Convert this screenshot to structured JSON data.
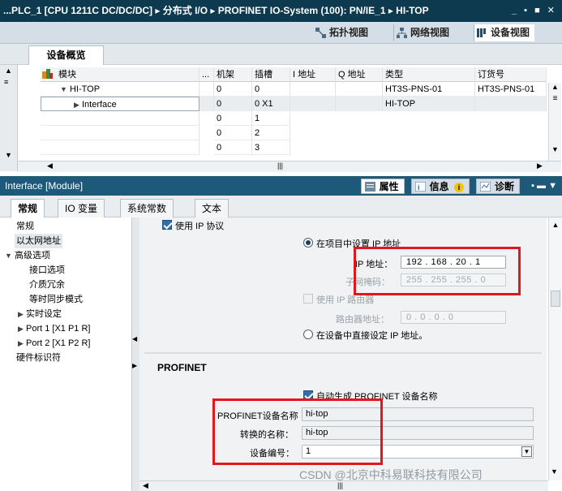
{
  "title_bar": {
    "path": "...PLC_1 [CPU 1211C DC/DC/DC]  ▸  分布式 I/O  ▸  PROFINET IO-System (100): PN/IE_1  ▸  HI-TOP",
    "controls": "_ ▪ ■ ✕"
  },
  "view_tabs": [
    "拓扑视图",
    "网络视图",
    "设备视图"
  ],
  "overview": {
    "tab_label": "设备概览",
    "columns": [
      "模块",
      "...",
      "机架",
      "插槽",
      "I 地址",
      "Q 地址",
      "类型",
      "订货号"
    ],
    "rows": [
      {
        "module": "HI-TOP",
        "rack": "0",
        "slot": "0",
        "type": "HT3S-PNS-01",
        "order": "HT3S-PNS-01"
      },
      {
        "module": "Interface",
        "rack": "0",
        "slot": "0 X1",
        "type": "HI-TOP",
        "order": ""
      },
      {
        "module": "",
        "rack": "0",
        "slot": "1",
        "type": "",
        "order": ""
      },
      {
        "module": "",
        "rack": "0",
        "slot": "2",
        "type": "",
        "order": ""
      },
      {
        "module": "",
        "rack": "0",
        "slot": "3",
        "type": "",
        "order": ""
      }
    ]
  },
  "panel": {
    "title": "Interface [Module]",
    "tabs": [
      "属性",
      "信息",
      "诊断"
    ],
    "subtabs": [
      "常规",
      "IO 变量",
      "系统常数",
      "文本"
    ]
  },
  "tree": {
    "items": [
      "常规",
      "以太网地址",
      "高级选项",
      "接口选项",
      "介质冗余",
      "等时同步模式",
      "实时设定",
      "Port 1 [X1 P1 R]",
      "Port 2 [X1 P2 R]",
      "硬件标识符"
    ]
  },
  "ip_section": {
    "use_ip_protocol": "使用 IP 协议",
    "set_in_project": "在项目中设置 IP 地址",
    "ip_label": "IP 地址：",
    "ip_value": "192 . 168 . 20  . 1",
    "subnet_label": "子网掩码：",
    "subnet_value": "255 . 255 . 255 . 0",
    "use_router": "使用 IP 路由器",
    "router_label": "路由器地址：",
    "router_value": "0  .  0  .  0  .  0",
    "set_direct": "在设备中直接设定 IP 地址。"
  },
  "profinet": {
    "title": "PROFINET",
    "auto_name": "自动生成 PROFINET 设备名称",
    "name_label": "PROFINET设备名称",
    "name_value": "hi-top",
    "converted_label": "转换的名称：",
    "converted_value": "hi-top",
    "number_label": "设备编号：",
    "number_value": "1"
  },
  "watermark": "CSDN @北京中科易联科技有限公司",
  "colors": {
    "highlight_box": "#e3171b",
    "title_bar": "#0e3a4f",
    "panel_title": "#1d5a7a"
  }
}
